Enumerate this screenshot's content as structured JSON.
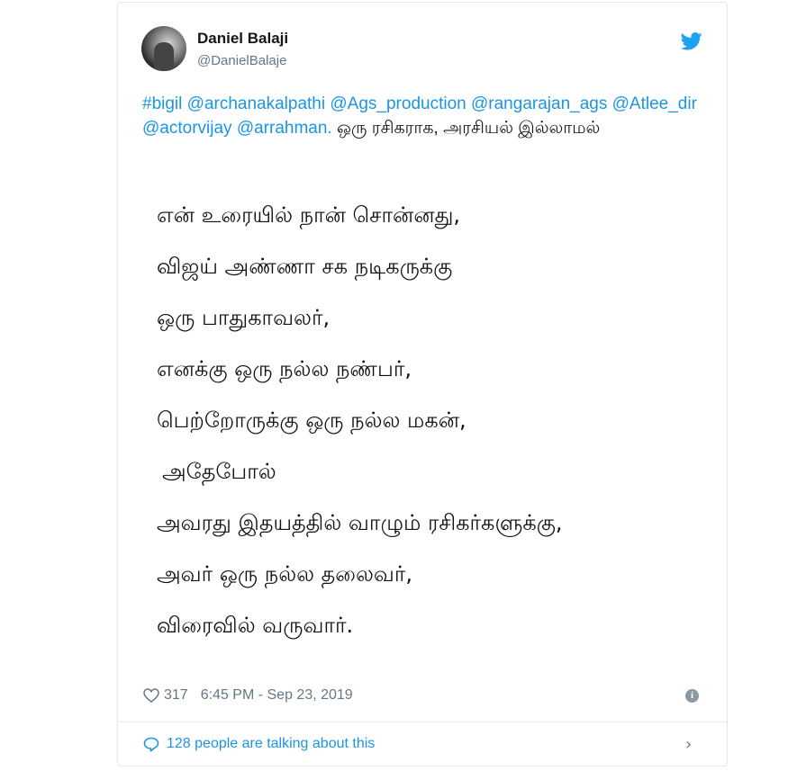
{
  "tweet": {
    "author_name": "Daniel Balaji",
    "author_handle": "@DanielBalaje",
    "intro_links": [
      "#bigil",
      "@archanakalpathi",
      "@Ags_production",
      "@rangarajan_ags",
      "@Atlee_dir",
      "@actorvijay",
      "@arrahman."
    ],
    "intro_text": "ஒரு ரசிகராக, அரசியல் இல்லாமல்",
    "poem_lines": [
      "என் உரையில் நான் சொன்னது,",
      "விஜய் அண்ணா சக நடிகருக்கு",
      "ஒரு பாதுகாவலர்,",
      "எனக்கு ஒரு நல்ல நண்பர்,",
      "பெற்றோருக்கு ஒரு நல்ல மகன்,",
      "அதேபோல்",
      "அவரது இதயத்தில் வாழும் ரசிகர்களுக்கு,",
      "அவர் ஒரு நல்ல தலைவர்,",
      "விரைவில் வருவார்."
    ],
    "likes": "317",
    "timestamp": "6:45 PM - Sep 23, 2019",
    "talking": "128 people are talking about this"
  },
  "icons": {
    "twitter": "twitter-bird-icon",
    "like": "heart-icon",
    "info": "info-icon",
    "comment": "speech-bubble-icon",
    "chevron": "chevron-right-icon"
  },
  "colors": {
    "link": "#1b95e0",
    "muted": "#657786",
    "text": "#14171a",
    "border": "#e1e8ed"
  }
}
